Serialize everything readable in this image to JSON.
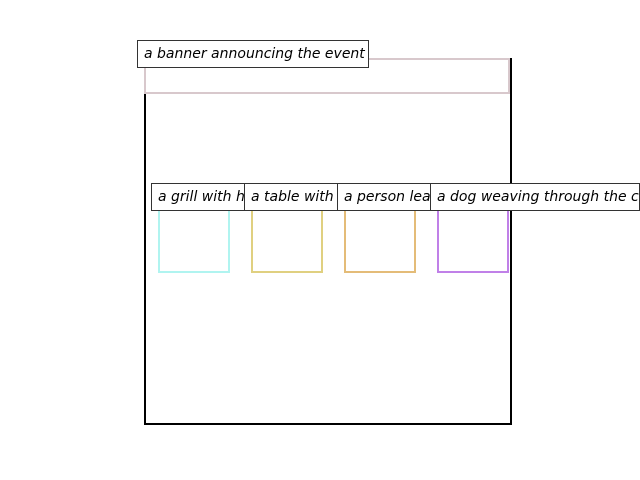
{
  "banner": {
    "label": "a banner announcing the event",
    "color": "#d8c8cc"
  },
  "items": [
    {
      "label": "a grill with hot dogs",
      "color": "#b0f4f0"
    },
    {
      "label": "a table with snacks",
      "color": "#e0d080"
    },
    {
      "label": "a person leading the dog",
      "color": "#e4bc78"
    },
    {
      "label": "a dog weaving through the crowd",
      "color": "#c080e8"
    }
  ]
}
